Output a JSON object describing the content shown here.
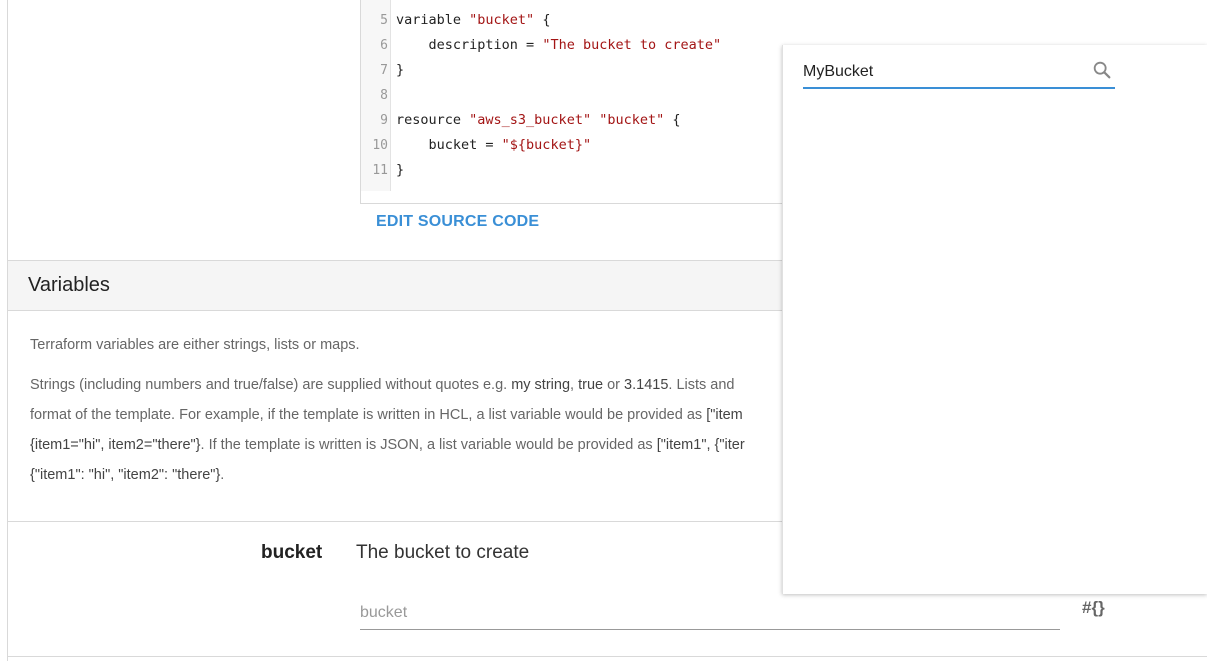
{
  "code": {
    "lines": [
      {
        "n": "5",
        "parts": [
          {
            "t": "variable "
          },
          {
            "t": "\"bucket\"",
            "s": true
          },
          {
            "t": " {"
          }
        ]
      },
      {
        "n": "6",
        "parts": [
          {
            "t": "    description = "
          },
          {
            "t": "\"The bucket to create\"",
            "s": true
          }
        ]
      },
      {
        "n": "7",
        "parts": [
          {
            "t": "}"
          }
        ]
      },
      {
        "n": "8",
        "parts": []
      },
      {
        "n": "9",
        "parts": [
          {
            "t": "resource "
          },
          {
            "t": "\"aws_s3_bucket\"",
            "s": true
          },
          {
            "t": " "
          },
          {
            "t": "\"bucket\"",
            "s": true
          },
          {
            "t": " {"
          }
        ]
      },
      {
        "n": "10",
        "parts": [
          {
            "t": "    bucket = "
          },
          {
            "t": "\"${bucket}\"",
            "s": true
          }
        ]
      },
      {
        "n": "11",
        "parts": [
          {
            "t": "}"
          }
        ]
      }
    ],
    "edit_label": "EDIT SOURCE CODE"
  },
  "variables": {
    "title": "Variables",
    "intro": "Terraform variables are either strings, lists or maps.",
    "p2_a": "Strings (including numbers and true/false) are supplied without quotes e.g. ",
    "p2_b": "my string",
    "p2_c": ", ",
    "p2_d": "true",
    "p2_e": " or ",
    "p2_f": "3.1415",
    "p2_g": ". Lists and",
    "p3_a": "format of the template. For example, if the template is written in HCL, a list variable would be provided as ",
    "p3_b": "[\"item",
    "p4_a": "{item1=\"hi\", item2=\"there\"}",
    "p4_b": ". If the template is written is JSON, a list variable would be provided as ",
    "p4_c": "[\"item1\", {\"iter",
    "p5_a": "{\"item1\": \"hi\", \"item2\": \"there\"}",
    "p5_b": "."
  },
  "bucket_var": {
    "name": "bucket",
    "description": "The bucket to create",
    "placeholder": "bucket",
    "interp_icon": "#{}"
  },
  "search": {
    "value": "MyBucket",
    "icon": "search-icon"
  },
  "colors": {
    "accent": "#3a8fd6",
    "string": "#a31515"
  }
}
